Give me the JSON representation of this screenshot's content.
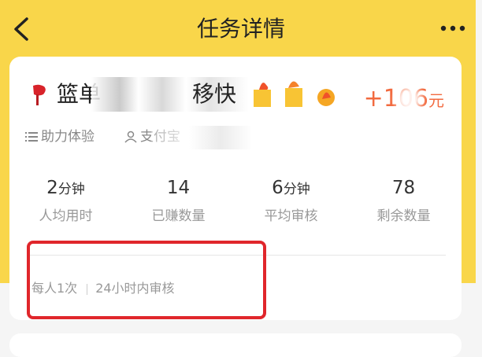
{
  "nav": {
    "title": "任务详情",
    "back_icon": "chevron-left-icon",
    "more_icon": "more-dots-icon"
  },
  "task": {
    "name_start": "篮单",
    "name_end": "移快",
    "reward_prefix": "+1",
    "reward_amount": "06",
    "reward_unit": "元",
    "tag_assist": "助力体验",
    "tag_payment": "支付宝"
  },
  "stats": [
    {
      "value": "2",
      "unit": "分钟",
      "label": "人均用时"
    },
    {
      "value": "14",
      "unit": "",
      "label": "已赚数量"
    },
    {
      "value": "6",
      "unit": "分钟",
      "label": "平均审核"
    },
    {
      "value": "78",
      "unit": "",
      "label": "剩余数量"
    }
  ],
  "rules": {
    "limit": "每人1次",
    "review": "24小时内审核"
  },
  "colors": {
    "header_yellow": "#f9d64a",
    "reward_orange": "#f26a3f",
    "highlight_red": "#e0262b"
  }
}
